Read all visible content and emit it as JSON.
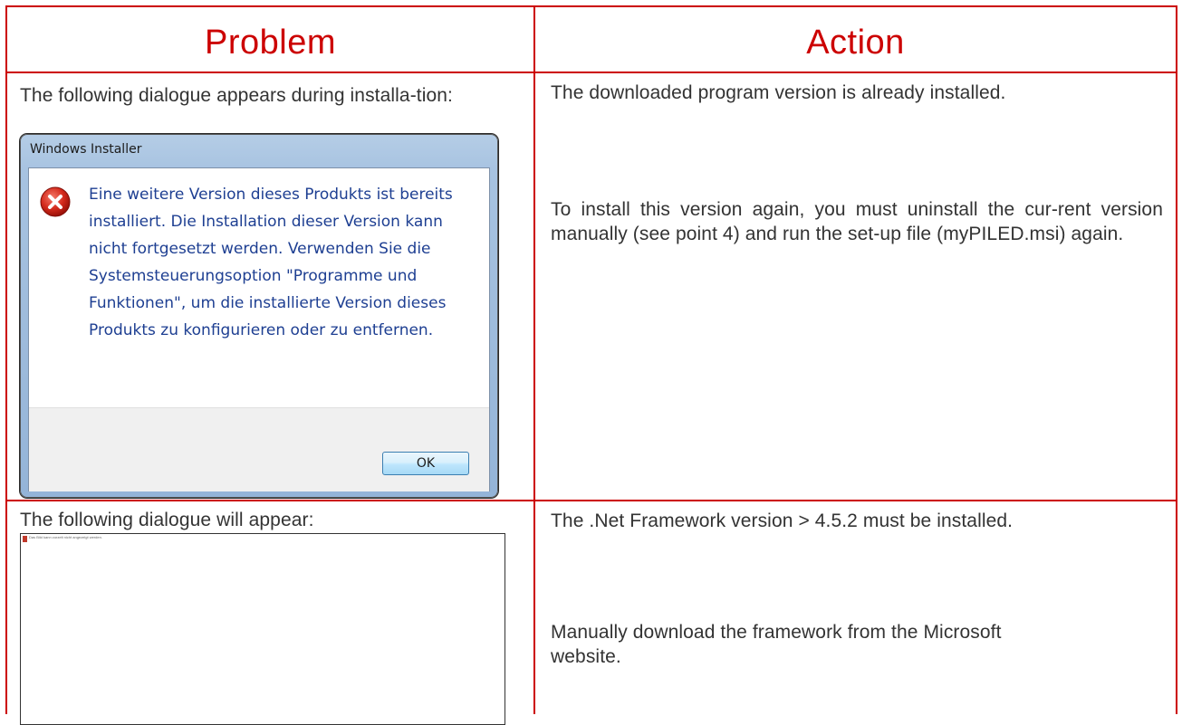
{
  "table": {
    "headers": {
      "problem": "Problem",
      "action": "Action"
    },
    "rows": [
      {
        "problem": "The following dialogue appears during installa-tion:",
        "action_lines": [
          "The downloaded program version is already installed.",
          "To install this version again, you must uninstall the cur-rent version manually (see point 4) and run the set-up file (myPILED.msi) again."
        ],
        "dialog": {
          "title": "Windows Installer",
          "icon": "error-icon",
          "message": "Eine weitere Version dieses Produkts ist bereits installiert. Die Installation dieser Version kann nicht fortgesetzt werden. Verwenden Sie die Systemsteuerungsoption \"Programme und Funktionen\", um die installierte Version dieses Produkts zu konfigurieren oder zu entfernen.",
          "ok_label": "OK"
        }
      },
      {
        "problem": "The following dialogue will appear:",
        "action_lines": [
          "The .Net Framework version > 4.5.2 must be installed.",
          "Manually download the framework from the Microsoft website."
        ],
        "dialog": {
          "title": "Das Bild kann zurzeit nicht angezeigt werden."
        }
      }
    ]
  },
  "colors": {
    "accent": "#cc0000",
    "dialog_text": "#1e3f92"
  }
}
